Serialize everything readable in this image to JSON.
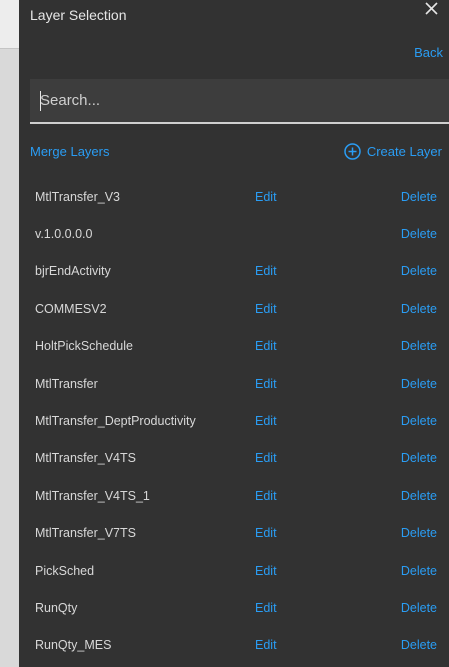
{
  "panel": {
    "title": "Layer Selection",
    "back_label": "Back",
    "close_glyph": "✕"
  },
  "search": {
    "placeholder": "Search...",
    "value": ""
  },
  "actions": {
    "merge_label": "Merge Layers",
    "create_label": "Create Layer",
    "create_icon": "plus-circle-icon"
  },
  "layers": [
    {
      "name": "MtlTransfer_V3",
      "edit": "Edit",
      "delete": "Delete"
    },
    {
      "name": "v.1.0.0.0.0",
      "edit": "",
      "delete": "Delete"
    },
    {
      "name": "bjrEndActivity",
      "edit": "Edit",
      "delete": "Delete"
    },
    {
      "name": "COMMESV2",
      "edit": "Edit",
      "delete": "Delete"
    },
    {
      "name": "HoltPickSchedule",
      "edit": "Edit",
      "delete": "Delete"
    },
    {
      "name": "MtlTransfer",
      "edit": "Edit",
      "delete": "Delete"
    },
    {
      "name": "MtlTransfer_DeptProductivity",
      "edit": "Edit",
      "delete": "Delete"
    },
    {
      "name": "MtlTransfer_V4TS",
      "edit": "Edit",
      "delete": "Delete"
    },
    {
      "name": "MtlTransfer_V4TS_1",
      "edit": "Edit",
      "delete": "Delete"
    },
    {
      "name": "MtlTransfer_V7TS",
      "edit": "Edit",
      "delete": "Delete"
    },
    {
      "name": "PickSched",
      "edit": "Edit",
      "delete": "Delete"
    },
    {
      "name": "RunQty",
      "edit": "Edit",
      "delete": "Delete"
    },
    {
      "name": "RunQty_MES",
      "edit": "Edit",
      "delete": "Delete"
    }
  ],
  "colors": {
    "accent": "#2a9df4",
    "panel_bg": "#323232",
    "text": "#d8d8d8"
  }
}
